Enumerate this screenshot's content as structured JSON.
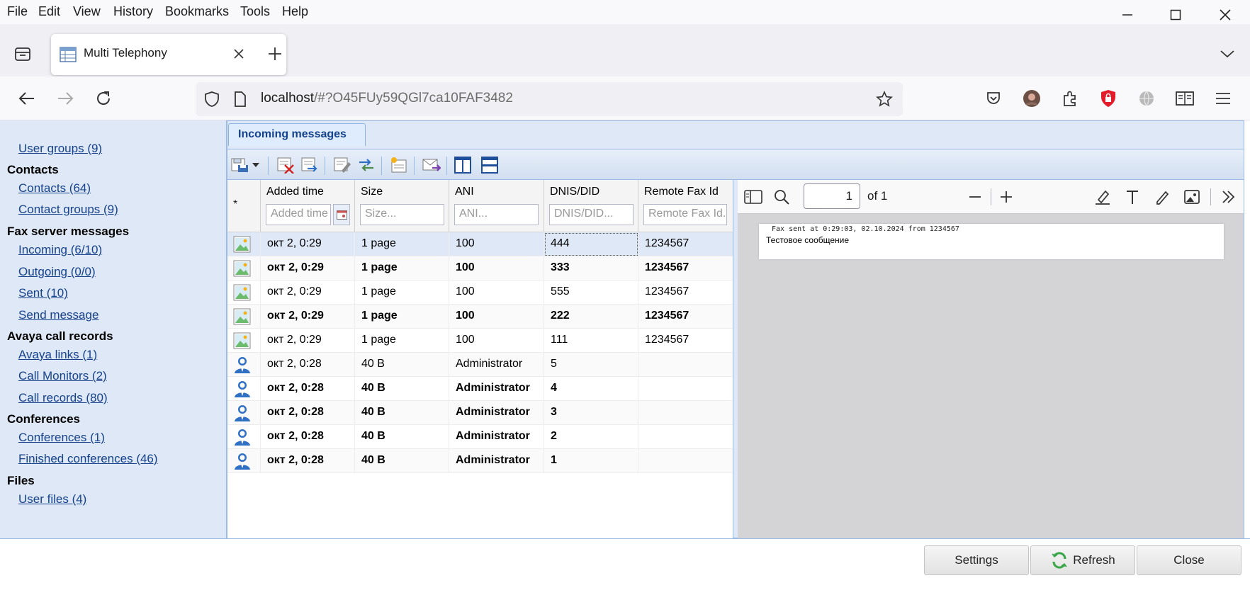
{
  "menu": [
    "File",
    "Edit",
    "View",
    "History",
    "Bookmarks",
    "Tools",
    "Help"
  ],
  "browser": {
    "tab_title": "Multi Telephony",
    "url_host": "localhost",
    "url_rest": "/#?O45FUy59QGl7ca10FAF3482"
  },
  "sidebar": {
    "items": [
      {
        "type": "link",
        "label": "User groups (9)"
      },
      {
        "type": "head",
        "label": "Contacts"
      },
      {
        "type": "link",
        "label": "Contacts (64)"
      },
      {
        "type": "link",
        "label": "Contact groups (9)"
      },
      {
        "type": "head",
        "label": "Fax server messages"
      },
      {
        "type": "link",
        "label": "Incoming (6/10)"
      },
      {
        "type": "link",
        "label": "Outgoing (0/0)"
      },
      {
        "type": "link",
        "label": "Sent (10)"
      },
      {
        "type": "link",
        "label": "Send message"
      },
      {
        "type": "head",
        "label": "Avaya call records"
      },
      {
        "type": "link",
        "label": "Avaya links (1)"
      },
      {
        "type": "link",
        "label": "Call Monitors (2)"
      },
      {
        "type": "link",
        "label": "Call records (80)"
      },
      {
        "type": "head",
        "label": "Conferences"
      },
      {
        "type": "link",
        "label": "Conferences (1)"
      },
      {
        "type": "link",
        "label": "Finished conferences (46)"
      },
      {
        "type": "head",
        "label": "Files"
      },
      {
        "type": "link",
        "label": "User files (4)"
      }
    ]
  },
  "panel": {
    "tab_label": "Incoming messages"
  },
  "grid": {
    "star": "*",
    "columns": [
      {
        "label": "Added time",
        "placeholder": "Added time"
      },
      {
        "label": "Size",
        "placeholder": "Size..."
      },
      {
        "label": "ANI",
        "placeholder": "ANI..."
      },
      {
        "label": "DNIS/DID",
        "placeholder": "DNIS/DID..."
      },
      {
        "label": "Remote Fax Id",
        "placeholder": "Remote Fax Id..."
      }
    ],
    "rows": [
      {
        "icon": "fax-image-icon",
        "bold": false,
        "selected": true,
        "cells": [
          "окт 2, 0:29",
          "1 page",
          "100",
          "444",
          "1234567"
        ]
      },
      {
        "icon": "fax-image-icon",
        "bold": true,
        "selected": false,
        "cells": [
          "окт 2, 0:29",
          "1 page",
          "100",
          "333",
          "1234567"
        ]
      },
      {
        "icon": "fax-image-icon",
        "bold": false,
        "selected": false,
        "cells": [
          "окт 2, 0:29",
          "1 page",
          "100",
          "555",
          "1234567"
        ]
      },
      {
        "icon": "fax-image-icon",
        "bold": true,
        "selected": false,
        "cells": [
          "окт 2, 0:29",
          "1 page",
          "100",
          "222",
          "1234567"
        ]
      },
      {
        "icon": "fax-image-icon",
        "bold": false,
        "selected": false,
        "cells": [
          "окт 2, 0:29",
          "1 page",
          "100",
          "111",
          "1234567"
        ]
      },
      {
        "icon": "user-icon",
        "bold": false,
        "selected": false,
        "cells": [
          "окт 2, 0:28",
          "40 B",
          "Administrator",
          "5",
          ""
        ]
      },
      {
        "icon": "user-icon",
        "bold": true,
        "selected": false,
        "cells": [
          "окт 2, 0:28",
          "40 B",
          "Administrator",
          "4",
          ""
        ]
      },
      {
        "icon": "user-icon",
        "bold": true,
        "selected": false,
        "cells": [
          "окт 2, 0:28",
          "40 B",
          "Administrator",
          "3",
          ""
        ]
      },
      {
        "icon": "user-icon",
        "bold": true,
        "selected": false,
        "cells": [
          "окт 2, 0:28",
          "40 B",
          "Administrator",
          "2",
          ""
        ]
      },
      {
        "icon": "user-icon",
        "bold": true,
        "selected": false,
        "cells": [
          "окт 2, 0:28",
          "40 B",
          "Administrator",
          "1",
          ""
        ]
      }
    ]
  },
  "pdf": {
    "page_number": "1",
    "page_count": "of 1",
    "header_line": "Fax sent at 0:29:03, 02.10.2024 from 1234567",
    "body_text": "Тестовое сообщение"
  },
  "footer": {
    "settings_label": "Settings",
    "refresh_label": "Refresh",
    "close_label": "Close"
  },
  "colors": {
    "accent": "#15428b",
    "panel_bg": "#dfe8f6",
    "border": "#99bbe8"
  }
}
